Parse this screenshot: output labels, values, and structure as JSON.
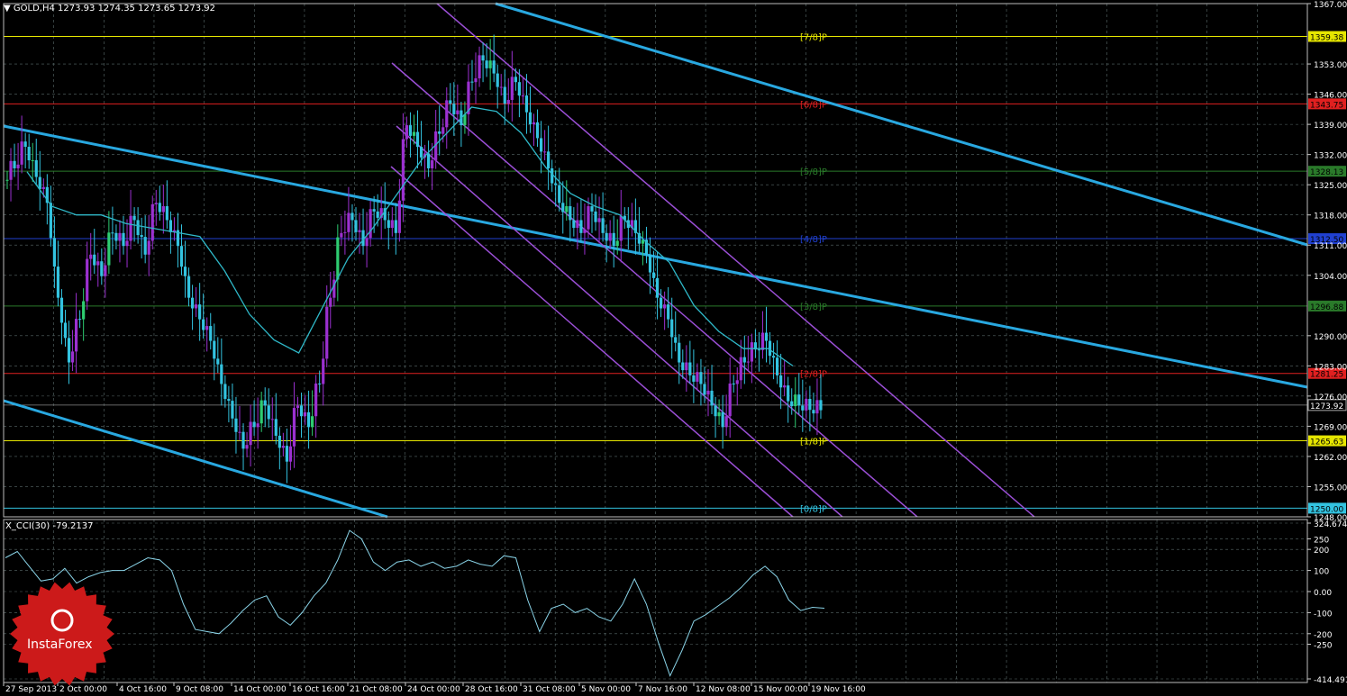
{
  "header": {
    "symbol": "GOLD,H4",
    "ohlc": "1273.93 1274.35 1273.65 1273.92"
  },
  "indicator": {
    "label": "X_CCI(30) -79.2137",
    "axis_labels": [
      "324.6748",
      "250",
      "200",
      "100",
      "0.00",
      "-100",
      "-200",
      "-250",
      "-414.4914"
    ],
    "axis_values": [
      324.6748,
      250,
      200,
      100,
      0,
      -100,
      -200,
      -250,
      -414.4914
    ]
  },
  "logo": {
    "text": "InstaForex"
  },
  "colors": {
    "background": "#000000",
    "grid": "#5a6a6a",
    "bull": "#9b30d0",
    "bear": "#33c3e0",
    "alt_candle": "#2ecc71",
    "trend_line": "#29a8e0",
    "channel": "#9b4fd6",
    "ma": "#2fb8c8",
    "cci_line": "#8ad4e8",
    "logo": "#cc1a1a"
  },
  "chart_data": {
    "type": "candlestick",
    "price_axis": {
      "min": 1248.0,
      "max": 1367.0,
      "ticks": [
        "1367.00",
        "1353.00",
        "1346.00",
        "1339.00",
        "1332.00",
        "1325.00",
        "1318.00",
        "1311.00",
        "1304.00",
        "1290.00",
        "1283.00",
        "1276.00",
        "1269.00",
        "1262.00",
        "1255.00",
        "1248.00"
      ],
      "tick_values": [
        1367,
        1353,
        1346,
        1339,
        1332,
        1325,
        1318,
        1311,
        1304,
        1290,
        1283,
        1276,
        1269,
        1262,
        1255,
        1248
      ]
    },
    "x_labels": [
      "27 Sep 2013",
      "2 Oct 00:00",
      "4 Oct 16:00",
      "9 Oct 08:00",
      "14 Oct 00:00",
      "16 Oct 16:00",
      "21 Oct 08:00",
      "24 Oct 00:00",
      "28 Oct 16:00",
      "31 Oct 08:00",
      "5 Nov 00:00",
      "7 Nov 16:00",
      "12 Nov 08:00",
      "15 Nov 00:00",
      "19 Nov 16:00"
    ],
    "murrey_levels": [
      {
        "label": "[7/8]P",
        "value": 1359.38,
        "price_label": "1359.38",
        "color": "#e6e600"
      },
      {
        "label": "[6/8]P",
        "value": 1343.75,
        "price_label": "1343.75",
        "color": "#e02020"
      },
      {
        "label": "[5/8]P",
        "value": 1328.13,
        "price_label": "1328.13",
        "color": "#2a7a2a"
      },
      {
        "label": "[4/8]P",
        "value": 1312.5,
        "price_label": "1312.50",
        "color": "#2040d0"
      },
      {
        "label": "[3/8]P",
        "value": 1296.88,
        "price_label": "1296.88",
        "color": "#2a7a2a"
      },
      {
        "label": "[2/8]P",
        "value": 1281.25,
        "price_label": "1281.25",
        "color": "#e02020"
      },
      {
        "label": "[1/8]P",
        "value": 1265.63,
        "price_label": "1265.63",
        "color": "#e6e600"
      },
      {
        "label": "[0/8]P",
        "value": 1250.0,
        "price_label": "1250.00",
        "color": "#33c3e0"
      }
    ],
    "current_price": {
      "value": 1273.92,
      "label": "1273.92"
    },
    "close_series": [
      1330,
      1335,
      1328,
      1322,
      1300,
      1285,
      1295,
      1310,
      1305,
      1315,
      1312,
      1318,
      1310,
      1322,
      1318,
      1312,
      1300,
      1295,
      1290,
      1280,
      1272,
      1265,
      1270,
      1275,
      1268,
      1262,
      1275,
      1270,
      1280,
      1300,
      1315,
      1318,
      1312,
      1320,
      1318,
      1315,
      1340,
      1335,
      1330,
      1338,
      1345,
      1340,
      1350,
      1355,
      1352,
      1345,
      1350,
      1343,
      1337,
      1330,
      1322,
      1318,
      1315,
      1320,
      1315,
      1312,
      1318,
      1315,
      1310,
      1300,
      1295,
      1285,
      1282,
      1280,
      1275,
      1270,
      1280,
      1285,
      1288,
      1290,
      1282,
      1276,
      1275,
      1274,
      1273.92
    ],
    "ma_series": [
      1328,
      1320,
      1318,
      1318,
      1316,
      1315,
      1314,
      1313,
      1305,
      1295,
      1289,
      1286,
      1297,
      1308,
      1315,
      1323,
      1331,
      1337,
      1343,
      1342,
      1337,
      1329,
      1323,
      1320,
      1318,
      1312,
      1307,
      1297,
      1291,
      1287,
      1287,
      1283
    ],
    "cci_series": [
      160,
      190,
      120,
      50,
      60,
      110,
      40,
      70,
      90,
      100,
      100,
      130,
      160,
      150,
      100,
      -60,
      -180,
      -190,
      -200,
      -150,
      -90,
      -40,
      -20,
      -120,
      -160,
      -100,
      -20,
      40,
      150,
      290,
      250,
      140,
      100,
      140,
      150,
      120,
      140,
      110,
      120,
      150,
      130,
      120,
      170,
      160,
      -40,
      -190,
      -80,
      -60,
      -100,
      -80,
      -120,
      -140,
      -60,
      60,
      -60,
      -240,
      -400,
      -280,
      -140,
      -110,
      -70,
      -30,
      20,
      80,
      120,
      70,
      -40,
      -90,
      -75,
      -79.2137
    ]
  }
}
